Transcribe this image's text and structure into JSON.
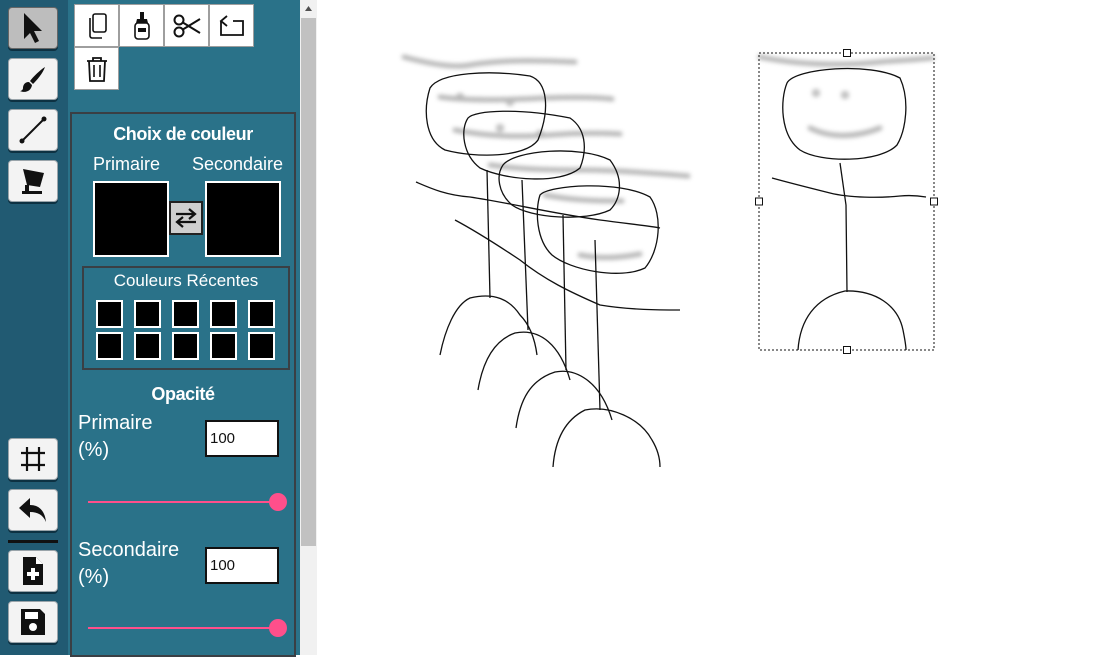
{
  "toolbar": {
    "tools": [
      {
        "name": "select-tool",
        "icon": "cursor-icon",
        "active": true
      },
      {
        "name": "brush-tool",
        "icon": "brush-icon"
      },
      {
        "name": "line-tool",
        "icon": "line-icon"
      },
      {
        "name": "fill-tool",
        "icon": "fill-icon"
      }
    ],
    "bottom_tools": [
      "crop-icon",
      "undo-icon",
      "new-file-icon",
      "save-icon"
    ]
  },
  "actions": [
    "copy-icon",
    "paste-icon",
    "cut-icon",
    "rotate-icon",
    "delete-icon"
  ],
  "colors": {
    "title": "Choix de couleur",
    "primary_label": "Primaire",
    "secondary_label": "Secondaire",
    "primary_color": "#000000",
    "secondary_color": "#000000",
    "recent_title": "Couleurs Récentes",
    "recent": [
      "#000000",
      "#000000",
      "#000000",
      "#000000",
      "#000000",
      "#000000",
      "#000000",
      "#000000",
      "#000000",
      "#000000"
    ]
  },
  "opacity": {
    "title": "Opacité",
    "primary_label": "Primaire",
    "primary_unit": "(%)",
    "primary_value": "100",
    "primary_fraction": 1.0,
    "secondary_label": "Secondaire",
    "secondary_unit": "(%)",
    "secondary_value": "100",
    "secondary_fraction": 1.0
  },
  "accent_color": "#ff4f8b",
  "panel_color": "#2a7289",
  "toolbar_color": "#215a72"
}
